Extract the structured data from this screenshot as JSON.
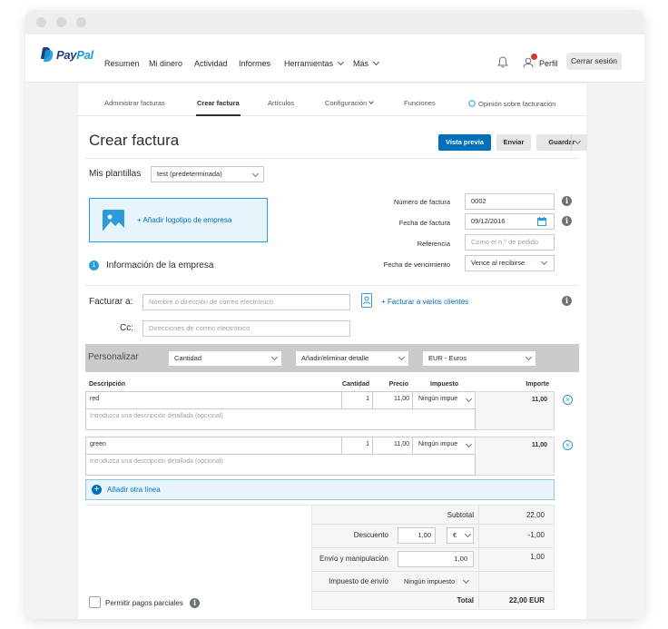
{
  "nav": {
    "brand_part1": "Pay",
    "brand_part2": "Pal",
    "items": [
      "Resumen",
      "Mi dinero",
      "Actividad",
      "Informes",
      "Herramientas",
      "Más"
    ],
    "profile_label": "Perfil",
    "logout_label": "Cerrar sesión"
  },
  "subnav": {
    "items": [
      "Administrar facturas",
      "Crear factura",
      "Artículos",
      "Configuración",
      "Funciones",
      "Opinión sobre facturación"
    ],
    "active_index": 1
  },
  "page": {
    "title": "Crear factura",
    "preview_label": "Vista previa",
    "send_label": "Enviar",
    "save_label": "Guardar"
  },
  "templates": {
    "label": "Mis plantillas",
    "value": "test (predeterminada)"
  },
  "company": {
    "add_logo_label": "+ Añadir logotipo de empresa",
    "info_label": "Información de la empresa",
    "step_number": "1"
  },
  "invoice_meta": {
    "number_label": "Número de factura",
    "number_value": "0002",
    "date_label": "Fecha de factura",
    "date_value": "09/12/2016",
    "reference_label": "Referencia",
    "reference_placeholder": "Como el n.º de pedido",
    "due_label": "Fecha de vencimiento",
    "due_value": "Vence al recibirse"
  },
  "billing": {
    "to_label": "Facturar a:",
    "to_placeholder": "Nombre o dirección de correo electrónico",
    "multi_label": "+ Facturar a varios clientes",
    "cc_label": "Cc:",
    "cc_placeholder": "Direcciones de correo electrónico"
  },
  "customize": {
    "label": "Personalizar",
    "quantity_option": "Cantidad",
    "detail_option": "Añadir/eliminar detalle",
    "currency_option": "EUR - Euros"
  },
  "table": {
    "headers": [
      "Descripción",
      "Cantidad",
      "Precio",
      "Impuesto",
      "Importe"
    ],
    "detail_placeholder": "Introduzca una descripción detallada (opcional)",
    "rows": [
      {
        "description": "red",
        "quantity": "1",
        "price": "11,00",
        "tax": "Ningún impue",
        "amount": "11,00"
      },
      {
        "description": "green",
        "quantity": "1",
        "price": "11,00",
        "tax": "Ningún impue",
        "amount": "11,00"
      }
    ],
    "add_line_label": "Añadir otra línea"
  },
  "totals": {
    "subtotal_label": "Subtotal",
    "subtotal_value": "22,00",
    "discount_label": "Descuento",
    "discount_input": "1,00",
    "discount_unit": "€",
    "discount_value": "-1,00",
    "shipping_label": "Envío y manipulación",
    "shipping_input": "1,00",
    "shipping_value": "1,00",
    "shipping_tax_label": "Impuesto de envío",
    "shipping_tax_value": "Ningún impuesto",
    "total_label": "Total",
    "total_value": "22,00 EUR"
  },
  "partial": {
    "label": "Permitir pagos parciales"
  }
}
